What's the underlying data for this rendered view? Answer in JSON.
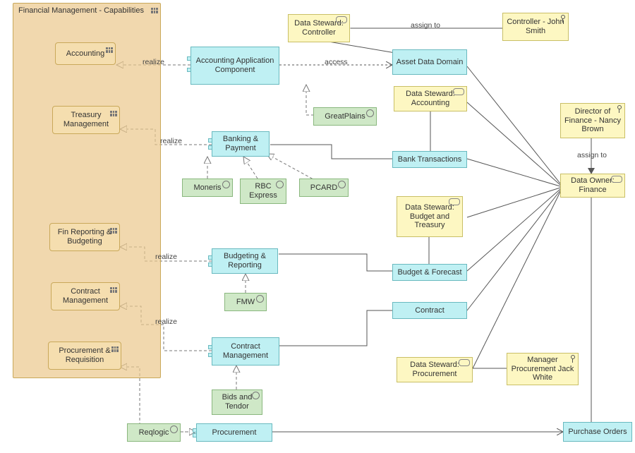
{
  "grouping": {
    "title": "Financial Management - Capabilities"
  },
  "capabilities": {
    "accounting": "Accounting",
    "treasury": "Treasury Management",
    "finreport": "Fin Reporting & Budgeting",
    "contract": "Contract Management",
    "procurement": "Procurement & Requisition"
  },
  "components": {
    "accounting": "Accounting Application Component",
    "banking": "Banking  & Payment",
    "budgeting": "Budgeting & Reporting",
    "contract": "Contract Management",
    "procurement": "Procurement"
  },
  "artifacts": {
    "greatplains": "GreatPlains",
    "moneris": "Moneris",
    "rbc": "RBC Express",
    "pcard": "PCARD",
    "fmw": "FMW",
    "bidstendor": "Bids and Tendor",
    "reqlogic": "Reqlogic"
  },
  "roles": {
    "ds_controller": "Data Steward: Controller",
    "ds_accounting": "Data Steward: Accounting",
    "ds_budget": "Data Steward: Budget and Treasury",
    "ds_procurement": "Data Steward: Procurement",
    "data_owner": "Data Owner: Finance"
  },
  "actors": {
    "controller": "Controller - John Smith",
    "director": "Director of Finance - Nancy Brown",
    "manager": "Manager Procurement Jack White"
  },
  "domains": {
    "asset": "Asset  Data Domain",
    "bank": "Bank Transactions",
    "budget": "Budget & Forecast",
    "contract": "Contract",
    "purchase": "Purchase Orders"
  },
  "labels": {
    "realize": "realize",
    "access": "access",
    "assign": "assign to"
  }
}
